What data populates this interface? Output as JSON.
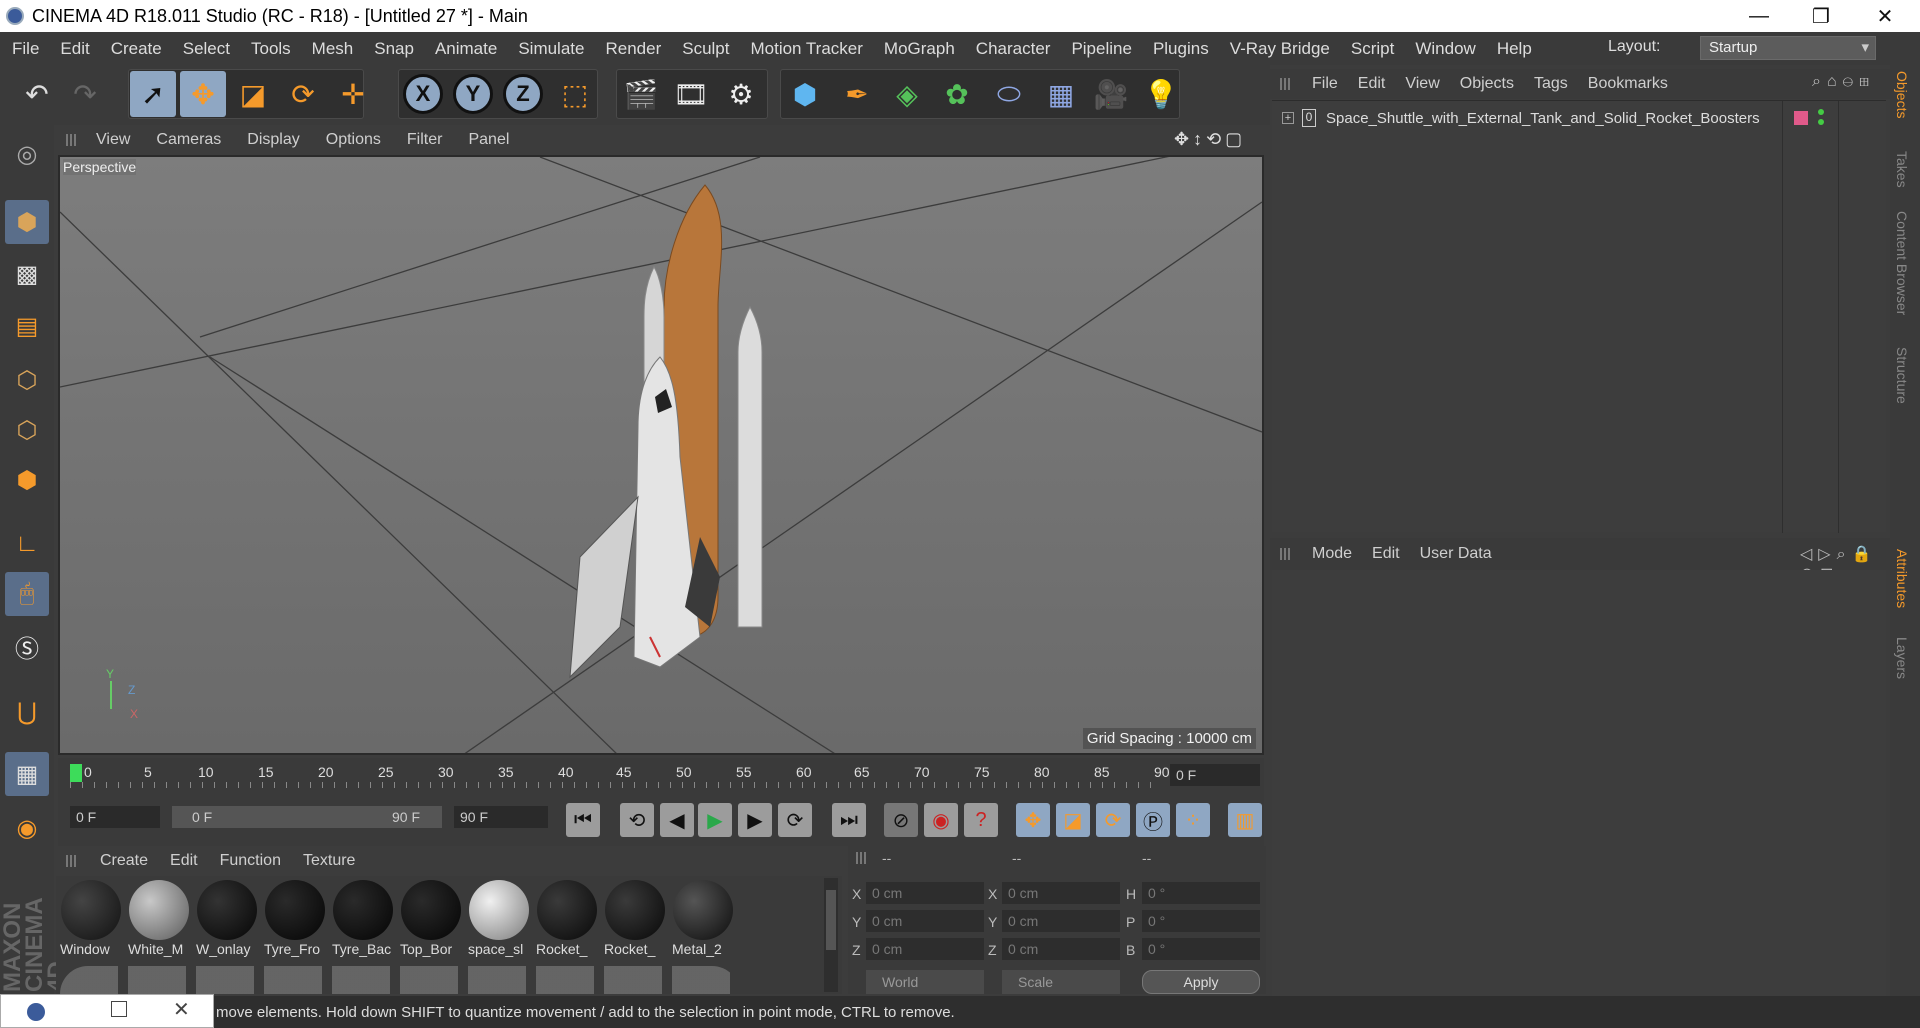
{
  "window": {
    "title": "CINEMA 4D R18.011 Studio (RC - R18) - [Untitled 27 *] - Main",
    "minimize": "—",
    "restore": "❐",
    "close": "✕"
  },
  "menubar": {
    "items": [
      "File",
      "Edit",
      "Create",
      "Select",
      "Tools",
      "Mesh",
      "Snap",
      "Animate",
      "Simulate",
      "Render",
      "Sculpt",
      "Motion Tracker",
      "MoGraph",
      "Character",
      "Pipeline",
      "Plugins",
      "V-Ray Bridge",
      "Script",
      "Window",
      "Help"
    ],
    "layout_label": "Layout:",
    "layout_value": "Startup"
  },
  "toolbar": {
    "x": "X",
    "y": "Y",
    "z": "Z"
  },
  "viewport": {
    "menu": [
      "View",
      "Cameras",
      "Display",
      "Options",
      "Filter",
      "Panel"
    ],
    "camera_label": "Perspective",
    "grid_spacing": "Grid Spacing : 10000 cm",
    "axis": {
      "y": "Y",
      "z": "Z",
      "x": "X"
    }
  },
  "timeline": {
    "ticks": [
      "0",
      "5",
      "10",
      "15",
      "20",
      "25",
      "30",
      "35",
      "40",
      "45",
      "50",
      "55",
      "60",
      "65",
      "70",
      "75",
      "80",
      "85",
      "90"
    ],
    "current_frame": "0 F"
  },
  "transport": {
    "start": "0 F",
    "range_start": "0 F",
    "range_end": "90 F",
    "end": "90 F"
  },
  "materials": {
    "menu": [
      "Create",
      "Edit",
      "Function",
      "Texture"
    ],
    "items": [
      {
        "label": "Window",
        "color": "#1a1a1a"
      },
      {
        "label": "White_M",
        "color": "#8a8a8a"
      },
      {
        "label": "W_onlay",
        "color": "#0c0c0c"
      },
      {
        "label": "Tyre_Fro",
        "color": "#080808"
      },
      {
        "label": "Tyre_Bac",
        "color": "#080808"
      },
      {
        "label": "Top_Bor",
        "color": "#0a0a0a"
      },
      {
        "label": "space_sl",
        "color": "#d8d8d8"
      },
      {
        "label": "Rocket_",
        "color": "#141414"
      },
      {
        "label": "Rocket_",
        "color": "#141414"
      },
      {
        "label": "Metal_2",
        "color": "#1e1e1e"
      }
    ]
  },
  "coords": {
    "headers": [
      "--",
      "--",
      "--"
    ],
    "rows": [
      {
        "l1": "X",
        "v1": "0 cm",
        "l2": "X",
        "v2": "0 cm",
        "l3": "H",
        "v3": "0 °"
      },
      {
        "l1": "Y",
        "v1": "0 cm",
        "l2": "Y",
        "v2": "0 cm",
        "l3": "P",
        "v3": "0 °"
      },
      {
        "l1": "Z",
        "v1": "0 cm",
        "l2": "Z",
        "v2": "0 cm",
        "l3": "B",
        "v3": "0 °"
      }
    ],
    "world": "World",
    "scale": "Scale",
    "apply": "Apply"
  },
  "objects": {
    "menu": [
      "File",
      "Edit",
      "View",
      "Objects",
      "Tags",
      "Bookmarks"
    ],
    "items": [
      {
        "name": "Space_Shuttle_with_External_Tank_and_Solid_Rocket_Boosters",
        "layer": "0"
      }
    ]
  },
  "attributes": {
    "menu": [
      "Mode",
      "Edit",
      "User Data"
    ]
  },
  "sidetabs": {
    "top": [
      "Objects",
      "Takes",
      "Content Browser",
      "Structure"
    ],
    "bottom": [
      "Attributes",
      "Layers"
    ]
  },
  "branding": "MAXON CINEMA 4D",
  "status": "move elements. Hold down SHIFT to quantize movement / add to the selection in point mode, CTRL to remove."
}
